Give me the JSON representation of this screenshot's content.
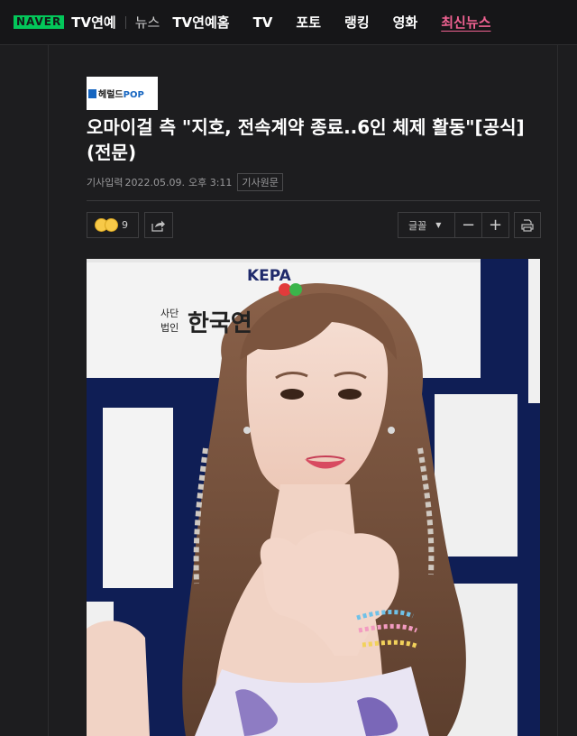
{
  "topnav": {
    "logo": "NAVER",
    "section": "TV연예",
    "items": [
      "뉴스",
      "TV연예홈",
      "TV",
      "포토",
      "랭킹",
      "영화",
      "최신뉴스"
    ]
  },
  "press": {
    "name_part1": "헤럴드",
    "name_part2": "POP"
  },
  "article": {
    "headline": "오마이걸 측 \"지호, 전속계약 종료..6인 체제 활동\"[공식](전문)",
    "published_label": "기사입력",
    "date": "2022.05.09.",
    "time": "오후 3:11",
    "source_label": "기사원문"
  },
  "toolbar": {
    "reaction_count": "9",
    "font_label": "글꼴",
    "minus_label": "−",
    "plus_label": "+"
  },
  "photo": {
    "backdrop_text_1": "KEPA",
    "backdrop_text_2": "사단",
    "backdrop_text_3": "법인",
    "backdrop_text_4": "한국연"
  },
  "colors": {
    "background": "#1d1d1f",
    "naver_green": "#03c75a",
    "active_nav": "#f06292",
    "headline": "#ffffff"
  }
}
